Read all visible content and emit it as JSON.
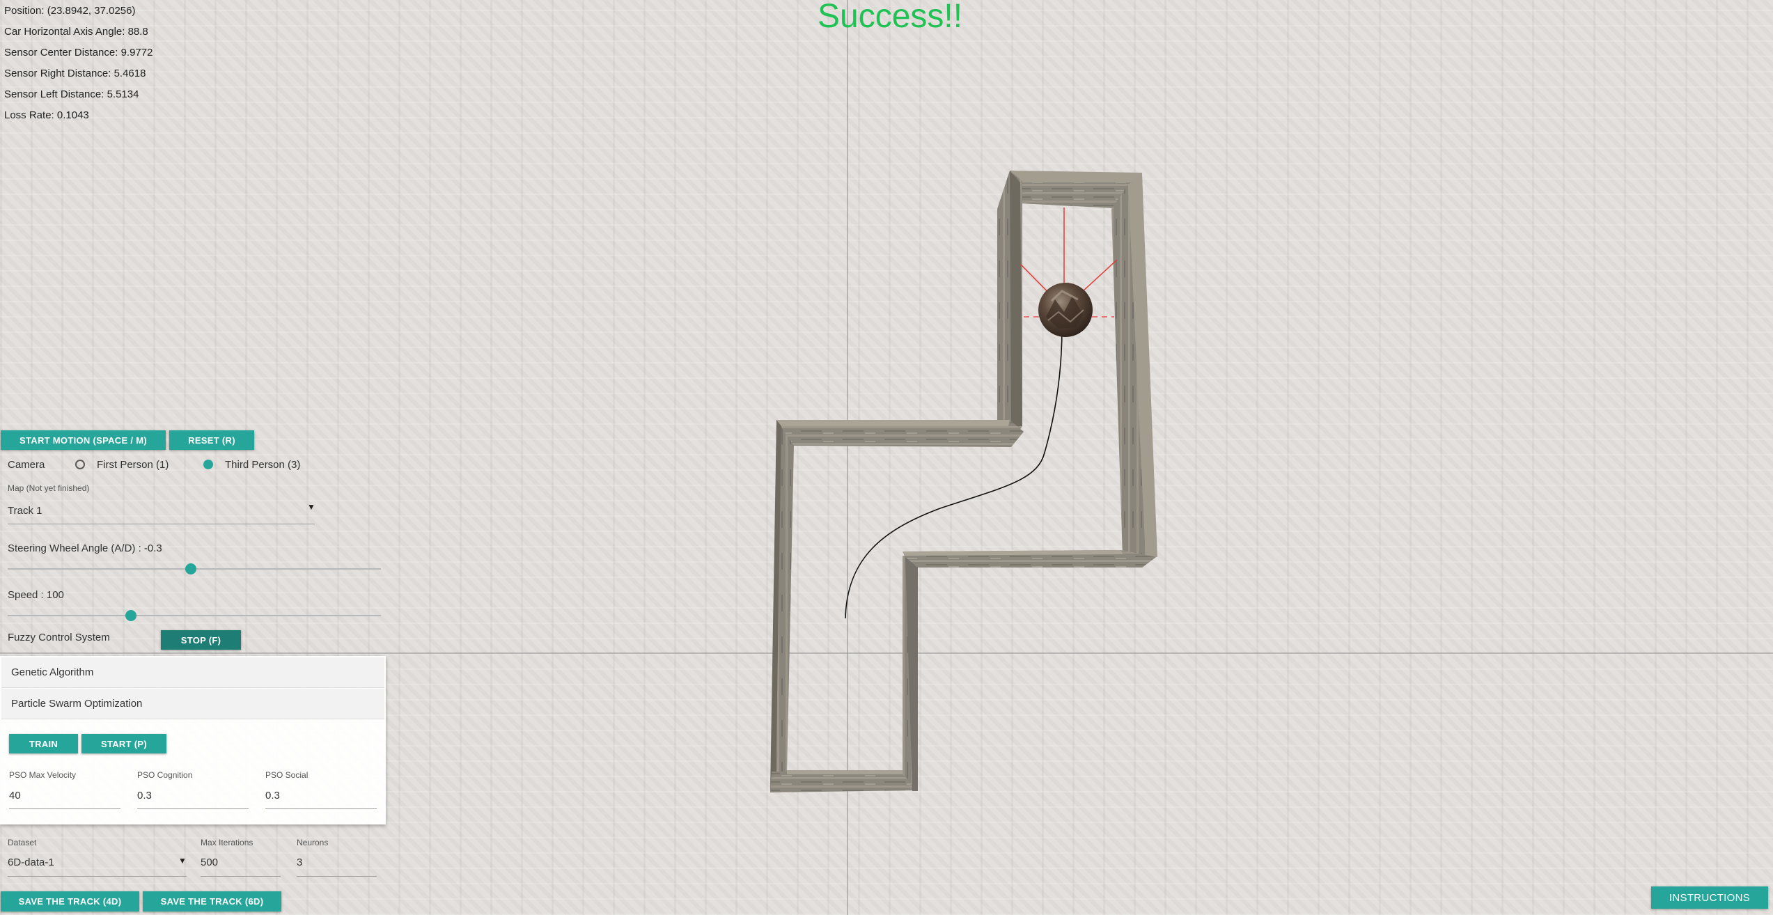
{
  "hud": {
    "position": "Position: (23.8942, 37.0256)",
    "angle": "Car Horizontal Axis Angle: 88.8",
    "center": "Sensor Center Distance: 9.9772",
    "right": "Sensor Right Distance: 5.4618",
    "left": "Sensor Left Distance: 5.5134",
    "loss": "Loss Rate: 0.1043"
  },
  "status": {
    "text": "Success!!",
    "color": "#1fc253"
  },
  "controls": {
    "start_motion": "START MOTION (SPACE / M)",
    "reset": "RESET (R)",
    "camera_label": "Camera",
    "first_person": "First Person (1)",
    "third_person": "Third Person (3)",
    "camera_selected": "third_person",
    "map_label": "Map (Not yet finished)",
    "map_value": "Track 1",
    "steering_label": "Steering Wheel Angle (A/D) : -0.3",
    "steering_fraction": 0.49,
    "speed_label": "Speed : 100",
    "speed_fraction": 0.33,
    "fuzzy_label": "Fuzzy Control System",
    "stop": "STOP (F)"
  },
  "algorithms": {
    "genetic": "Genetic Algorithm",
    "pso": "Particle Swarm Optimization",
    "train": "TRAIN",
    "start": "START (P)",
    "max_velocity_label": "PSO Max Velocity",
    "max_velocity": "40",
    "cognition_label": "PSO Cognition",
    "cognition": "0.3",
    "social_label": "PSO Social",
    "social": "0.3"
  },
  "dataset": {
    "label": "Dataset",
    "value": "6D-data-1",
    "max_iter_label": "Max Iterations",
    "max_iter": "500",
    "neurons_label": "Neurons",
    "neurons": "3"
  },
  "footer": {
    "save4d": "SAVE THE TRACK (4D)",
    "save6d": "SAVE THE TRACK (6D)",
    "instructions": "INSTRUCTIONS"
  },
  "colors": {
    "accent": "#26a69a",
    "accent_dark": "#1e7d74",
    "sensor": "#e53935"
  },
  "icons": {
    "dropdown": "caret-down-icon",
    "car": "sphere-car-icon"
  }
}
